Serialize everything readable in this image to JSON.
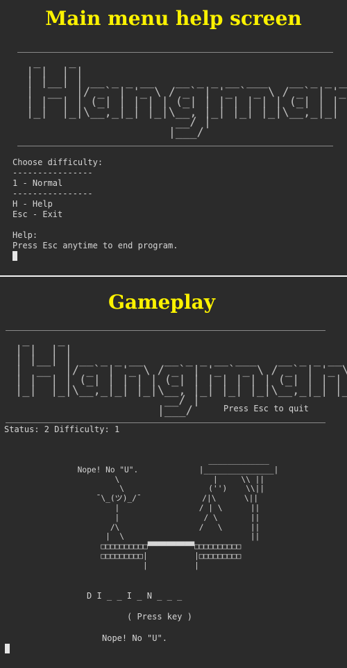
{
  "panel_top": {
    "caption": "Main menu help screen",
    "logo_art": " _    _\n| |  | |\n| |__| | __ _ _ __   __ _ _ __ ___   __ _ _ __\n|  __  |/ _` | '_ \\ / _` | '_ ` _ \\ / _` | '_ \\\n| |  | | (_| | | | | (_| | | | | | | (_| | | | |\n|_|  |_|\\__,_|_| |_|\\__, |_| |_| |_|\\__,_|_| |_|\n                     __/ |\n                    |___/",
    "menu": {
      "heading": "Choose difficulty:",
      "separator": "----------------",
      "option_normal": "1 - Normal",
      "option_help": "H - Help",
      "option_exit": "Esc - Exit",
      "help_label": "Help:",
      "help_text": "Press Esc anytime to end program."
    }
  },
  "panel_bottom": {
    "caption": "Gameplay",
    "logo_art": " _    _\n| |  | |\n| |__| | __ _ _ __   __ _ _ __ ___   __ _ _ __\n|  __  |/ _` | '_ \\ / _` | '_ ` _ \\ / _` | '_ \\\n| |  | | (_| | | | | (_| | | | | | | (_| | | | |\n|_|  |_|\\__,_|_| |_|\\__, |_| |_| |_|\\__,_|_| |_|\n                     __/ |\n                    |___/",
    "quit_hint": "Press Esc to quit",
    "status_line": "Status: 2 Difficulty: 1",
    "gallows_art": "                                 _____________\n     Nope! No \"U\".             |_______________|\n             \\                    |     \\\\ ||\n              \\                  ('')    \\\\||\n         ¯\\_(ツ)_/¯             /|\\      \\||\n             |                 / | \\      ||\n             |                  / \\       ||\n            /\\                 /   \\      ||\n           |  \\                           ||\n          □□□□□□□□□□▀▀▀▀▀▀▀▀▀▀□□□□□□□□□□\n          □□□□□□□□□|          |□□□□□□□□□\n                   |          |",
    "word": "D I _ _ I _ N _ _ _",
    "press_key": "( Press key )",
    "message": "Nope! No \"U\"."
  }
}
